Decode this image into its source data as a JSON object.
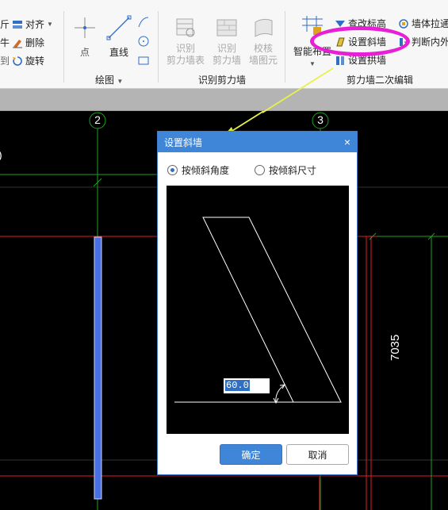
{
  "ribbon": {
    "left_group": {
      "align_label": "对齐",
      "delete_label": "删除",
      "rotate_label": "旋转",
      "cut_labels": [
        "斤",
        "牛",
        "到"
      ]
    },
    "draw_group": {
      "point_label": "点",
      "line_label": "直线",
      "group_label": "绘图"
    },
    "identify_group": {
      "tool1_lines": [
        "识别",
        "剪力墙表"
      ],
      "tool2_lines": [
        "识别",
        "剪力墙"
      ],
      "tool3_lines": [
        "校核",
        "墙图元"
      ],
      "group_label": "识别剪力墙"
    },
    "edit_group": {
      "smart_layout_label": "智能布置",
      "modify_elevation_label": "查改标高",
      "set_slanted_wall_label": "设置斜墙",
      "set_arch_wall_label": "设置拱墙",
      "wall_stretch_label": "墙体拉通",
      "judge_inner_outer_label": "判断内外",
      "group_label": "剪力墙二次编辑"
    },
    "highlight_color": "#e81fd6"
  },
  "canvas": {
    "axis_labels": [
      "2",
      "3"
    ],
    "dimension_text": "7035",
    "arrow_color": "#e8f04a"
  },
  "dialog": {
    "title": "设置斜墙",
    "close_glyph": "×",
    "radio_angle": "按倾斜角度",
    "radio_size": "按倾斜尺寸",
    "selected_mode": "angle",
    "angle_value": "60.0",
    "ok_label": "确定",
    "cancel_label": "取消"
  }
}
